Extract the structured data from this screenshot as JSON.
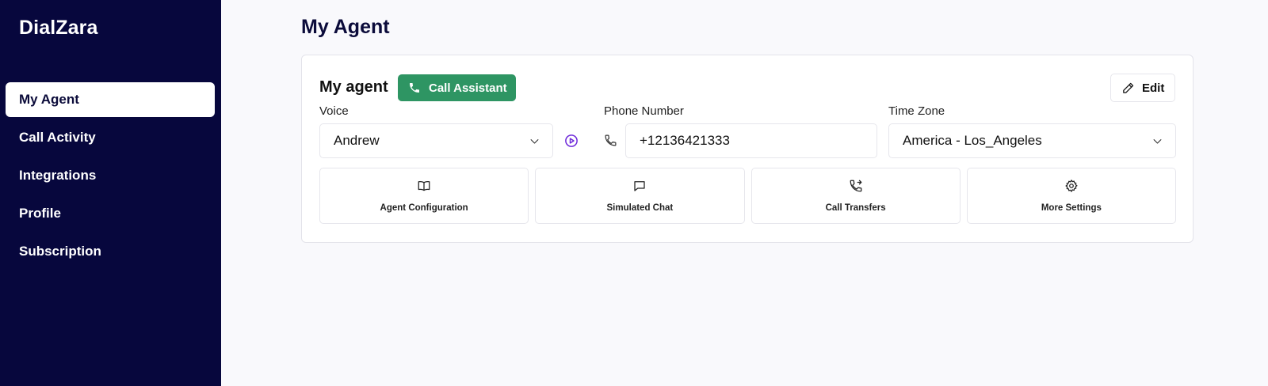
{
  "sidebar": {
    "brand": "DialZara",
    "items": [
      {
        "label": "My Agent",
        "active": true
      },
      {
        "label": "Call Activity",
        "active": false
      },
      {
        "label": "Integrations",
        "active": false
      },
      {
        "label": "Profile",
        "active": false
      },
      {
        "label": "Subscription",
        "active": false
      }
    ]
  },
  "main": {
    "page_title": "My Agent",
    "card": {
      "title": "My agent",
      "call_button_label": "Call Assistant",
      "edit_button_label": "Edit",
      "voice": {
        "label": "Voice",
        "value": "Andrew"
      },
      "phone": {
        "label": "Phone Number",
        "value": "+12136421333"
      },
      "timezone": {
        "label": "Time Zone",
        "value": "America - Los_Angeles"
      },
      "tiles": [
        {
          "label": "Agent Configuration",
          "icon": "book-icon"
        },
        {
          "label": "Simulated Chat",
          "icon": "chat-icon"
        },
        {
          "label": "Call Transfers",
          "icon": "phone-forward-icon"
        },
        {
          "label": "More Settings",
          "icon": "gear-icon"
        }
      ]
    }
  },
  "colors": {
    "sidebar_bg": "#07073d",
    "accent_green": "#2e9563",
    "play_purple": "#6d28d9",
    "page_bg": "#f9f9fc"
  }
}
